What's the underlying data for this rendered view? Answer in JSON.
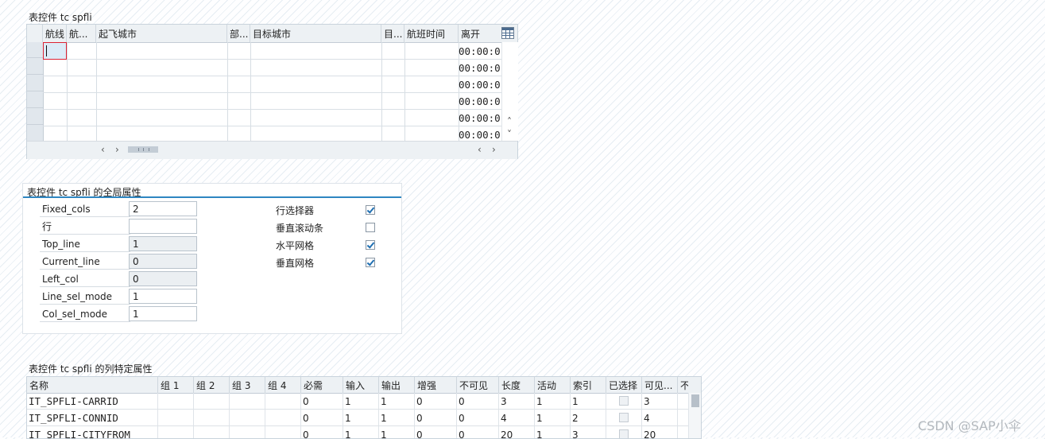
{
  "section1": {
    "title": "表控件 tc spfli",
    "columns": [
      "航线",
      "航...",
      "起飞城市",
      "部...",
      "目标城市",
      "目...",
      "航班时间",
      "离开"
    ],
    "time_values": [
      "00:00:0",
      "00:00:0",
      "00:00:0",
      "00:00:0",
      "00:00:0",
      "00:00:0"
    ],
    "settings_icon": "table-settings-icon",
    "scroll_up": "˄",
    "scroll_down": "˅",
    "scroll_left": "‹",
    "scroll_right": "›"
  },
  "section2": {
    "title": "表控件 tc spfli 的全局属性",
    "fields": [
      {
        "label": "Fixed_cols",
        "value": "2",
        "readonly": false
      },
      {
        "label": "行",
        "value": "",
        "readonly": false
      },
      {
        "label": "Top_line",
        "value": "1",
        "readonly": true
      },
      {
        "label": "Current_line",
        "value": "0",
        "readonly": true
      },
      {
        "label": "Left_col",
        "value": "0",
        "readonly": true
      },
      {
        "label": "Line_sel_mode",
        "value": "1",
        "readonly": false
      },
      {
        "label": "Col_sel_mode",
        "value": "1",
        "readonly": false
      }
    ],
    "checkboxes": [
      {
        "label": "行选择器",
        "checked": true
      },
      {
        "label": "垂直滚动条",
        "checked": false
      },
      {
        "label": "水平网格",
        "checked": true
      },
      {
        "label": "垂直网格",
        "checked": true
      }
    ],
    "accent_color": "#2e86c1"
  },
  "section3": {
    "title": "表控件 tc spfli 的列特定属性",
    "columns": [
      "名称",
      "组 1",
      "组 2",
      "组 3",
      "组 4",
      "必需",
      "输入",
      "输出",
      "增强",
      "不可见",
      "长度",
      "活动",
      "索引",
      "已选择",
      "可见...",
      "不"
    ],
    "rows": [
      {
        "name": "IT_SPFLI-CARRID",
        "required": "0",
        "input": "1",
        "output": "1",
        "enhance": "0",
        "invisible": "0",
        "length": "3",
        "active": "1",
        "index": "1",
        "visible_len": "3"
      },
      {
        "name": "IT_SPFLI-CONNID",
        "required": "0",
        "input": "1",
        "output": "1",
        "enhance": "0",
        "invisible": "0",
        "length": "4",
        "active": "1",
        "index": "2",
        "visible_len": "4"
      },
      {
        "name": "IT_SPFLI-CITYFROM",
        "required": "0",
        "input": "1",
        "output": "1",
        "enhance": "0",
        "invisible": "0",
        "length": "20",
        "active": "1",
        "index": "3",
        "visible_len": "20"
      }
    ]
  },
  "watermark": "CSDN @SAP小伞"
}
